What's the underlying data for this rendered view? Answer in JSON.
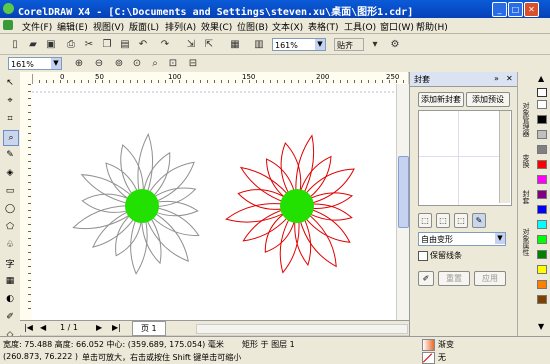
{
  "window": {
    "title": "CorelDRAW X4 - [C:\\Documents and Settings\\steven.xu\\桌面\\图形1.cdr]"
  },
  "menu": [
    "文件(F)",
    "编辑(E)",
    "视图(V)",
    "版面(L)",
    "排列(A)",
    "效果(C)",
    "位图(B)",
    "文本(X)",
    "表格(T)",
    "工具(O)",
    "窗口(W)",
    "帮助(H)"
  ],
  "toolbar": {
    "zoom_value": "161%",
    "snap_label": "贴齐"
  },
  "propbar": {
    "zoom_value": "161%"
  },
  "ruler": {
    "h_ticks": [
      "0",
      "50",
      "100",
      "150",
      "200",
      "250"
    ],
    "unit": "毫米"
  },
  "pages": {
    "counter": "1 / 1",
    "tab": "页 1"
  },
  "docker": {
    "title": "封套",
    "add_new_label": "添加新封套",
    "add_preset_label": "添加预设",
    "mode_value": "自由变形",
    "keep_lines_label": "保留线条",
    "reset_label": "重置",
    "apply_label": "应用"
  },
  "vtabs": [
    "对象管理器",
    "变换",
    "封套",
    "对象属性"
  ],
  "palette": [
    "#ffffff",
    "#000000",
    "#c0c0c0",
    "#808080",
    "#ff0000",
    "#ff00ff",
    "#800080",
    "#0000ff",
    "#00ffff",
    "#00ff00",
    "#008000",
    "#ffff00",
    "#ff8000",
    "#804000"
  ],
  "status": {
    "line1": "宽度: 75.488  高度: 66.052  中心: (359.689, 175.054)  毫米",
    "object_info": "矩形 于 图层 1",
    "fill_label": "渐变",
    "line2_coords": "(260.873, 76.222 )",
    "line2_hint": "单击可放大，右击或按住 Shift 键单击可缩小",
    "outline_label": "无"
  },
  "colors": {
    "flower_left": "#909090",
    "flower_right": "#e00000",
    "center": "#22e000"
  }
}
